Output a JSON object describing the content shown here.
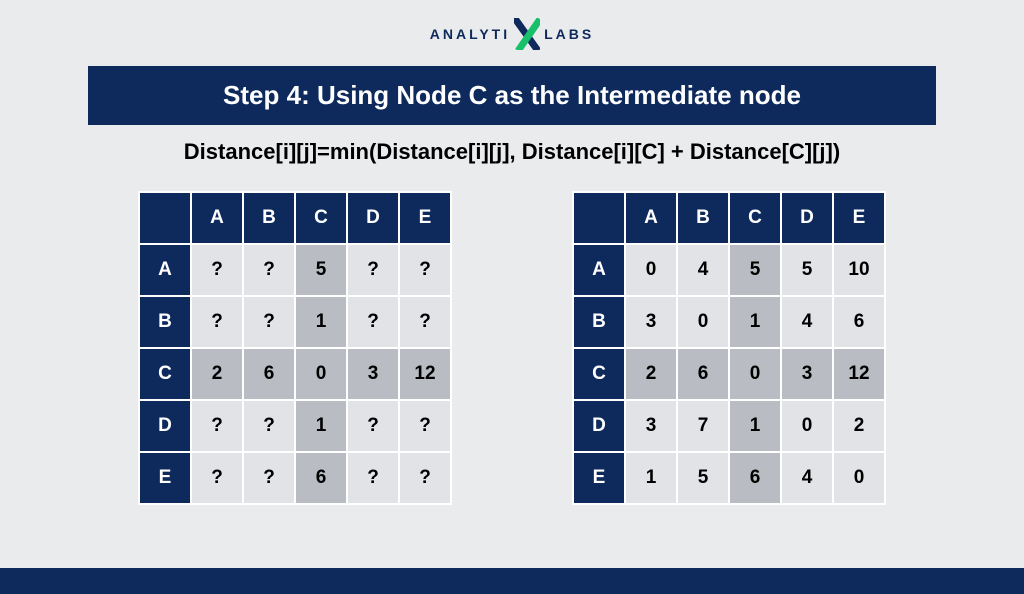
{
  "logo": {
    "left": "ANALYTI",
    "right": "LABS"
  },
  "title": "Step 4: Using Node C as the Intermediate node",
  "formula": "Distance[i][j]=min(Distance[i][j], Distance[i][C] + Distance[C][j])",
  "columns": [
    "A",
    "B",
    "C",
    "D",
    "E"
  ],
  "rows": [
    "A",
    "B",
    "C",
    "D",
    "E"
  ],
  "highlight_col": "C",
  "highlight_row": "C",
  "left_table": [
    [
      "?",
      "?",
      "5",
      "?",
      "?"
    ],
    [
      "?",
      "?",
      "1",
      "?",
      "?"
    ],
    [
      "2",
      "6",
      "0",
      "3",
      "12"
    ],
    [
      "?",
      "?",
      "1",
      "?",
      "?"
    ],
    [
      "?",
      "?",
      "6",
      "?",
      "?"
    ]
  ],
  "right_table": [
    [
      "0",
      "4",
      "5",
      "5",
      "10"
    ],
    [
      "3",
      "0",
      "1",
      "4",
      "6"
    ],
    [
      "2",
      "6",
      "0",
      "3",
      "12"
    ],
    [
      "3",
      "7",
      "1",
      "0",
      "2"
    ],
    [
      "1",
      "5",
      "6",
      "4",
      "0"
    ]
  ]
}
